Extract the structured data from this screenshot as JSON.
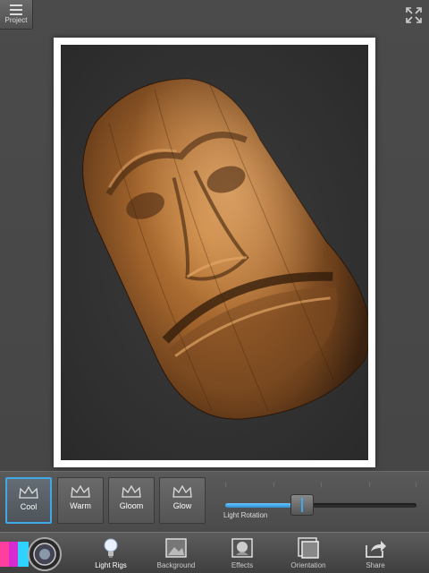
{
  "header": {
    "project_label": "Project",
    "project_icon": "menu-icon",
    "fullscreen_icon": "fullscreen-icon"
  },
  "canvas": {
    "frame_color": "#ffffff",
    "background_color": "#2e2e2e",
    "subject": "wooden-carved-face"
  },
  "presets": [
    {
      "label": "Cool",
      "active": true
    },
    {
      "label": "Warm",
      "active": false
    },
    {
      "label": "Gloom",
      "active": false
    },
    {
      "label": "Glow",
      "active": false
    }
  ],
  "slider": {
    "label": "Light Rotation",
    "value_fraction": 0.4,
    "accent": "#3fa9e8"
  },
  "toolbar": {
    "items": [
      {
        "label": "Light Rigs",
        "icon": "light-bulb-icon",
        "active": true
      },
      {
        "label": "Background",
        "icon": "background-icon",
        "active": false
      },
      {
        "label": "Effects",
        "icon": "effects-icon",
        "active": false
      },
      {
        "label": "Orientation",
        "icon": "orientation-icon",
        "active": false
      },
      {
        "label": "Share",
        "icon": "share-icon",
        "active": false
      }
    ]
  }
}
